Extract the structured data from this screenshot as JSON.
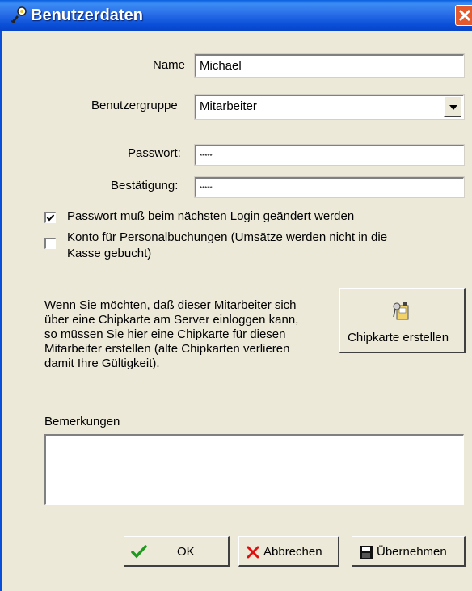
{
  "window": {
    "title": "Benutzerdaten",
    "icon": "user-key-icon",
    "close_icon": "close-icon"
  },
  "form": {
    "name_label": "Name",
    "name_value": "Michael",
    "group_label": "Benutzergruppe",
    "group_value": "Mitarbeiter",
    "password_label": "Passwort:",
    "password_value": "*****",
    "confirm_label": "Bestätigung:",
    "confirm_value": "*****"
  },
  "options": {
    "must_change_label": "Passwort muß beim nächsten Login geändert werden",
    "must_change_checked": true,
    "staff_account_label_line1": "Konto für Personalbuchungen (Umsätze werden nicht in die",
    "staff_account_label_line2": "Kasse gebucht)",
    "staff_account_checked": false
  },
  "chipcard": {
    "info_lines": [
      "Wenn Sie möchten, daß dieser Mitarbeiter sich",
      "über eine Chipkarte am Server einloggen kann,",
      "so müssen Sie hier eine Chipkarte für diesen",
      "Mitarbeiter erstellen (alte Chipkarten verlieren",
      "damit Ihre Gültigkeit)."
    ],
    "button_label": "Chipkarte erstellen",
    "button_icon": "chipcard-key-icon"
  },
  "remarks": {
    "label": "Bemerkungen",
    "value": ""
  },
  "buttons": {
    "ok_label": "OK",
    "cancel_label": "Abbrechen",
    "apply_label": "Übernehmen"
  },
  "colors": {
    "titlebar": "#0A4FD8",
    "dialog_bg": "#ECE9D8",
    "ok_check": "#1E9A1E",
    "cancel_x": "#E01010"
  }
}
